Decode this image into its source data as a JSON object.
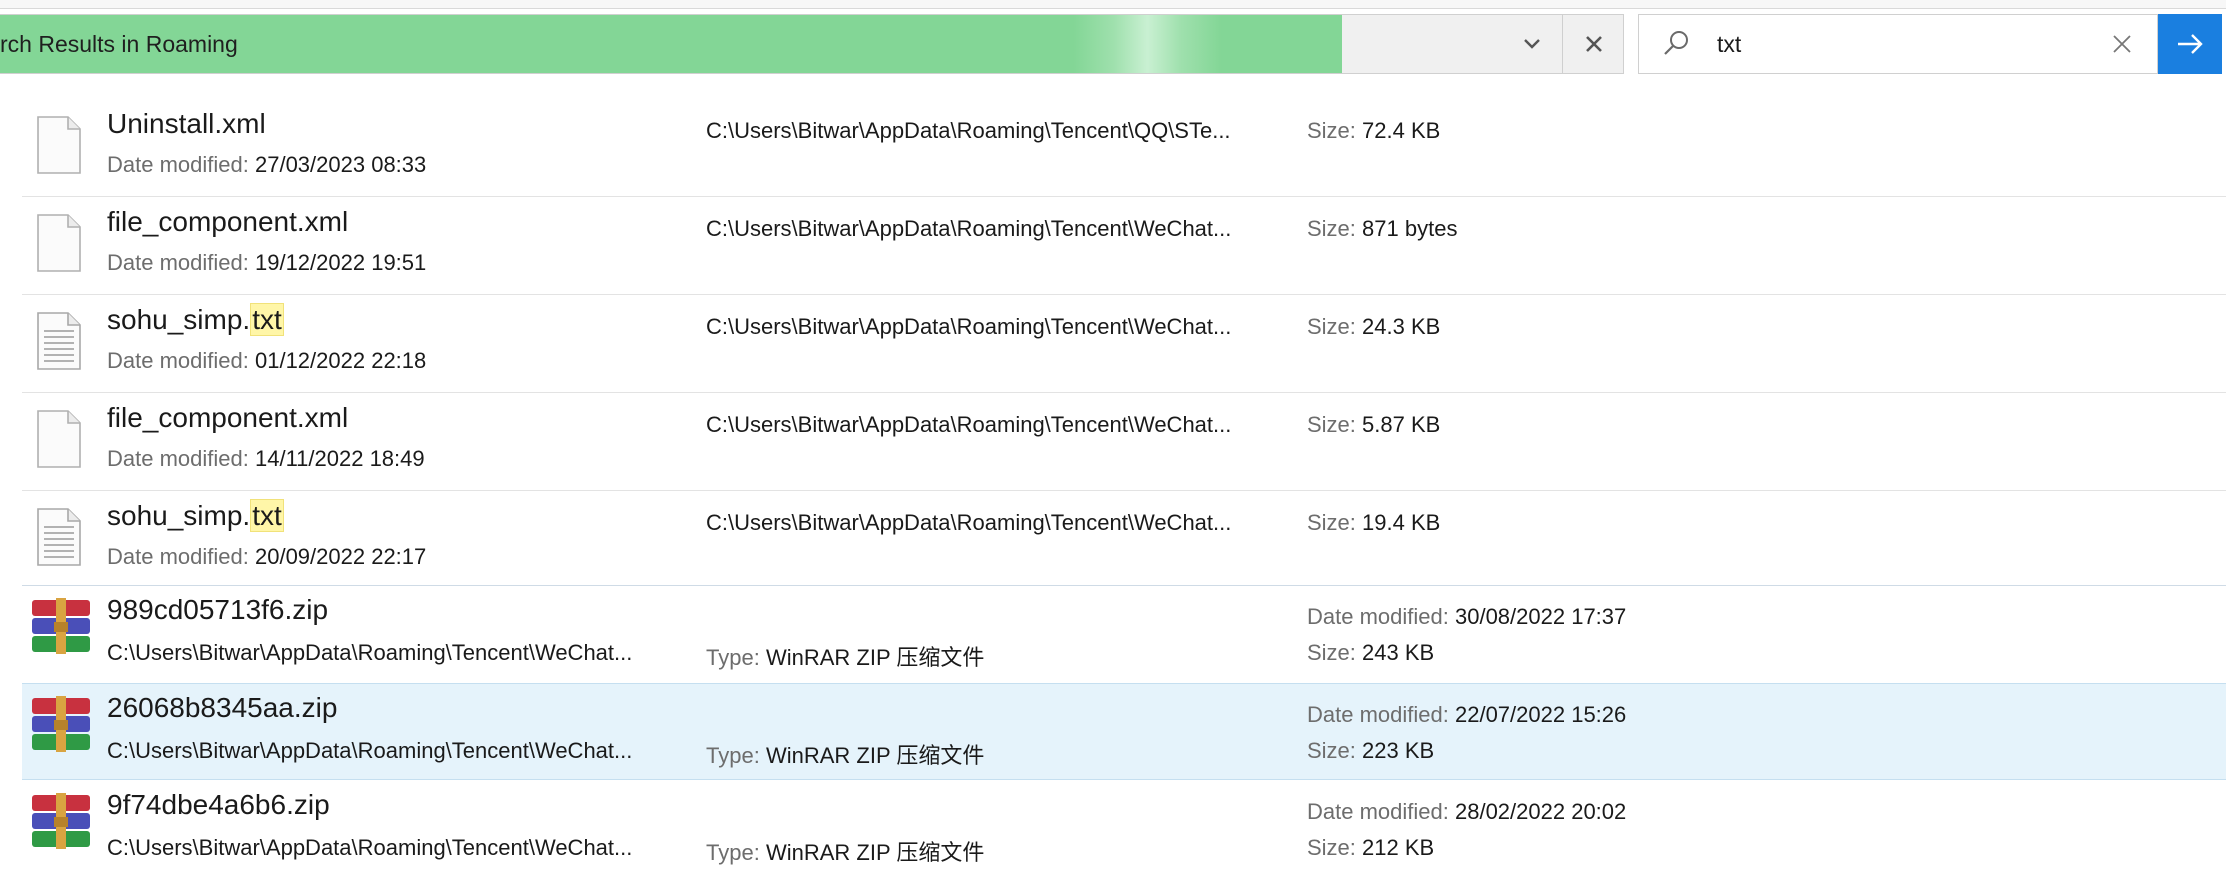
{
  "address": {
    "text": "rch Results in Roaming"
  },
  "search": {
    "value": "txt",
    "placeholder": ""
  },
  "labels": {
    "date_modified": "Date modified:",
    "size": "Size:",
    "type": "Type:"
  },
  "files": [
    {
      "name_prefix": "Uninstall.xml",
      "name_highlight": "",
      "date_modified": "27/03/2023 08:33",
      "path": "C:\\Users\\Bitwar\\AppData\\Roaming\\Tencent\\QQ\\STe...",
      "size": "72.4 KB",
      "icon": "text-document-icon"
    },
    {
      "name_prefix": "file_component.xml",
      "name_highlight": "",
      "date_modified": "19/12/2022 19:51",
      "path": "C:\\Users\\Bitwar\\AppData\\Roaming\\Tencent\\WeChat...",
      "size": "871 bytes",
      "icon": "text-document-icon"
    },
    {
      "name_prefix": "sohu_simp.",
      "name_highlight": "txt",
      "date_modified": "01/12/2022 22:18",
      "path": "C:\\Users\\Bitwar\\AppData\\Roaming\\Tencent\\WeChat...",
      "size": "24.3 KB",
      "icon": "text-file-icon"
    },
    {
      "name_prefix": "file_component.xml",
      "name_highlight": "",
      "date_modified": "14/11/2022 18:49",
      "path": "C:\\Users\\Bitwar\\AppData\\Roaming\\Tencent\\WeChat...",
      "size": "5.87 KB",
      "icon": "text-document-icon"
    },
    {
      "name_prefix": "sohu_simp.",
      "name_highlight": "txt",
      "date_modified": "20/09/2022 22:17",
      "path": "C:\\Users\\Bitwar\\AppData\\Roaming\\Tencent\\WeChat...",
      "size": "19.4 KB",
      "icon": "text-file-icon"
    }
  ],
  "archives": [
    {
      "name": "989cd05713f6.zip",
      "path": "C:\\Users\\Bitwar\\AppData\\Roaming\\Tencent\\WeChat...",
      "type": "WinRAR ZIP 压缩文件",
      "date_modified": "30/08/2022 17:37",
      "size": "243 KB",
      "icon": "winrar-archive-icon",
      "selected": false
    },
    {
      "name": "26068b8345aa.zip",
      "path": "C:\\Users\\Bitwar\\AppData\\Roaming\\Tencent\\WeChat...",
      "type": "WinRAR ZIP 压缩文件",
      "date_modified": "22/07/2022 15:26",
      "size": "223 KB",
      "icon": "winrar-archive-icon",
      "selected": true
    },
    {
      "name": "9f74dbe4a6b6.zip",
      "path": "C:\\Users\\Bitwar\\AppData\\Roaming\\Tencent\\WeChat...",
      "type": "WinRAR ZIP 压缩文件",
      "date_modified": "28/02/2022 20:02",
      "size": "212 KB",
      "icon": "winrar-archive-icon",
      "selected": false
    }
  ],
  "colors": {
    "progress": "#83d696",
    "accent": "#1a7fe0",
    "highlight": "#fff6a8",
    "selection": "#e5f3fb"
  }
}
